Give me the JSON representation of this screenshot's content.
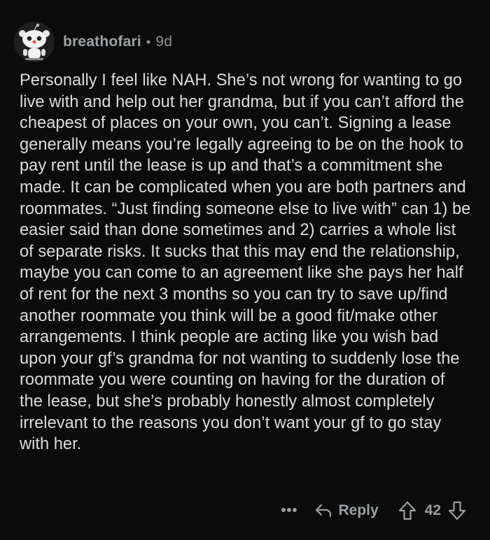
{
  "comment": {
    "author": "breathofari",
    "separator": "•",
    "age": "9d",
    "text": "Personally I feel like NAH. She’s not wrong for wanting to go live with and help out her grandma, but if you can’t afford the cheapest of places on your own, you can’t. Signing a lease generally means you’re legally agreeing to be on the hook to pay rent until the lease is up and that’s a commitment she made. It can be complicated when you are both partners and roommates. “Just finding someone else to live with” can 1) be easier said than done sometimes and 2) carries a whole list of separate risks. It sucks that this may end the relationship, maybe you can come to an agreement like she pays her half of rent for the next 3 months so you can try to save up/find another roommate you think will be a good fit/make other arrangements. I think people are acting like you wish bad upon your gf’s grandma for not wanting to suddenly lose the roommate you were counting on having for the duration of the lease, but she’s probably honestly almost completely irrelevant to the reasons you don’t want your gf to go stay with her."
  },
  "actions": {
    "more_label": "•••",
    "reply_label": "Reply",
    "score": "42"
  },
  "icons": {
    "avatar": "snoo-avatar-icon",
    "more": "more-options-icon",
    "reply": "reply-arrow-icon",
    "upvote": "upvote-arrow-icon",
    "downvote": "downvote-arrow-icon"
  },
  "colors": {
    "background": "#0b0b0b",
    "text": "#dcdcdc",
    "muted": "#8e9396"
  }
}
